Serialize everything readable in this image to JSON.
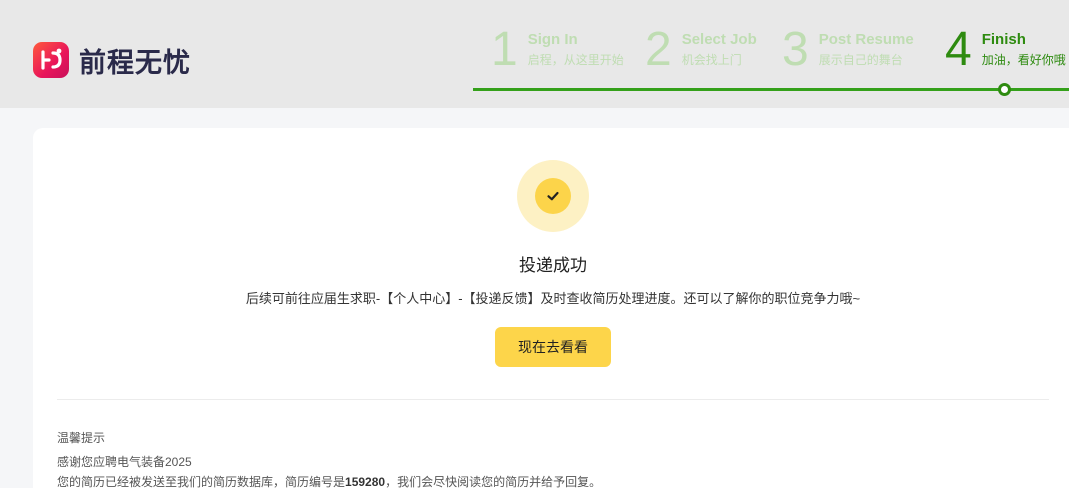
{
  "brand": {
    "name": "前程无忧",
    "logo_icon": "51job-logo-icon"
  },
  "steps": [
    {
      "number": "1",
      "title": "Sign In",
      "subtitle": "启程，从这里开始"
    },
    {
      "number": "2",
      "title": "Select Job",
      "subtitle": "机会找上门"
    },
    {
      "number": "3",
      "title": "Post Resume",
      "subtitle": "展示自己的舞台"
    },
    {
      "number": "4",
      "title": "Finish",
      "subtitle": "加油，看好你哦"
    }
  ],
  "active_step": "4",
  "colors": {
    "accent_green": "#2e8b10",
    "inactive_green": "#bfddb2",
    "button_yellow": "#fdd54a"
  },
  "result": {
    "icon": "check-icon",
    "title": "投递成功",
    "description": "后续可前往应届生求职-【个人中心】-【投递反馈】及时查收简历处理进度。还可以了解你的职位竞争力哦~",
    "button_label": "现在去看看"
  },
  "tips": {
    "heading": "温馨提示",
    "line1": "感谢您应聘电气装备2025",
    "line2_prefix": "您的简历已经被发送至我们的简历数据库，简历编号是",
    "resume_id": "159280",
    "line2_suffix": "，我们会尽快阅读您的简历并给予回复。"
  }
}
